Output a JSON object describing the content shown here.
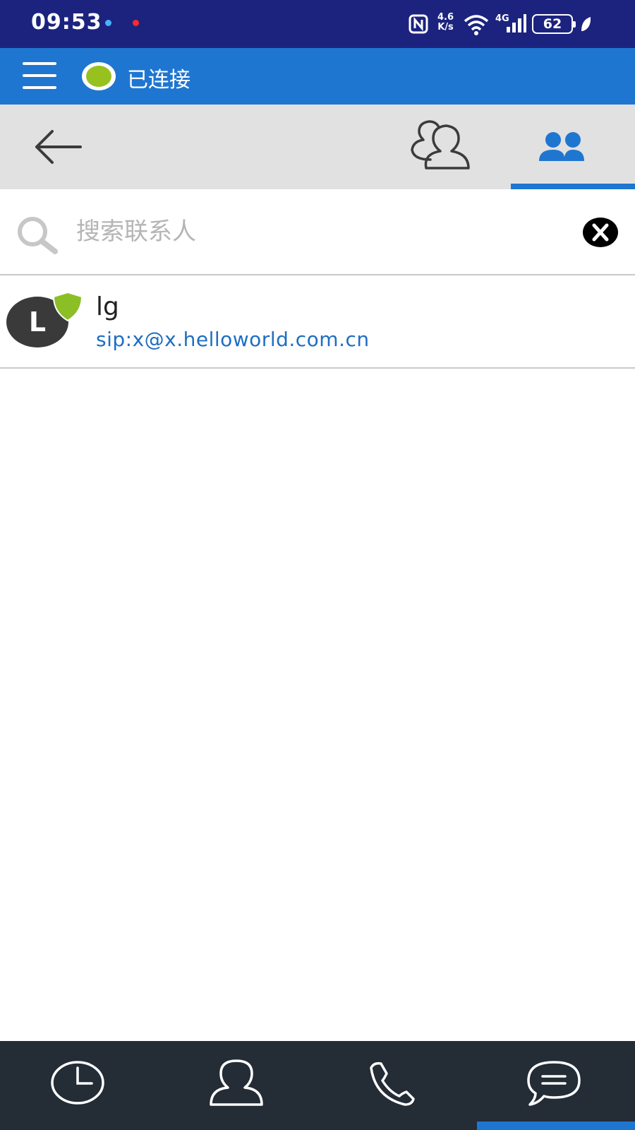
{
  "status_bar": {
    "time": "09:53",
    "net_speed_value": "4.6",
    "net_speed_unit": "K/s",
    "battery": "62"
  },
  "app_bar": {
    "connection_status": "已连接",
    "connection_color": "#97c11f"
  },
  "toolbar": {
    "back_icon": "back-arrow-icon",
    "tabs": [
      {
        "icon": "contacts-outline-icon",
        "selected": false
      },
      {
        "icon": "group-icon",
        "selected": true
      }
    ]
  },
  "search": {
    "placeholder": "搜索联系人",
    "value": ""
  },
  "contacts": [
    {
      "initial": "L",
      "name": "lg",
      "sip": "sip:x@x.helloworld.com.cn",
      "badge_icon": "shield-icon"
    }
  ],
  "bottom_nav": {
    "items": [
      {
        "icon": "clock-icon"
      },
      {
        "icon": "contact-icon"
      },
      {
        "icon": "phone-icon"
      },
      {
        "icon": "chat-icon",
        "selected": true
      }
    ]
  },
  "colors": {
    "status_bar": "#1c237e",
    "app_bar": "#1f76d1",
    "accent": "#1f76d1",
    "bottom_nav": "#242c36"
  }
}
